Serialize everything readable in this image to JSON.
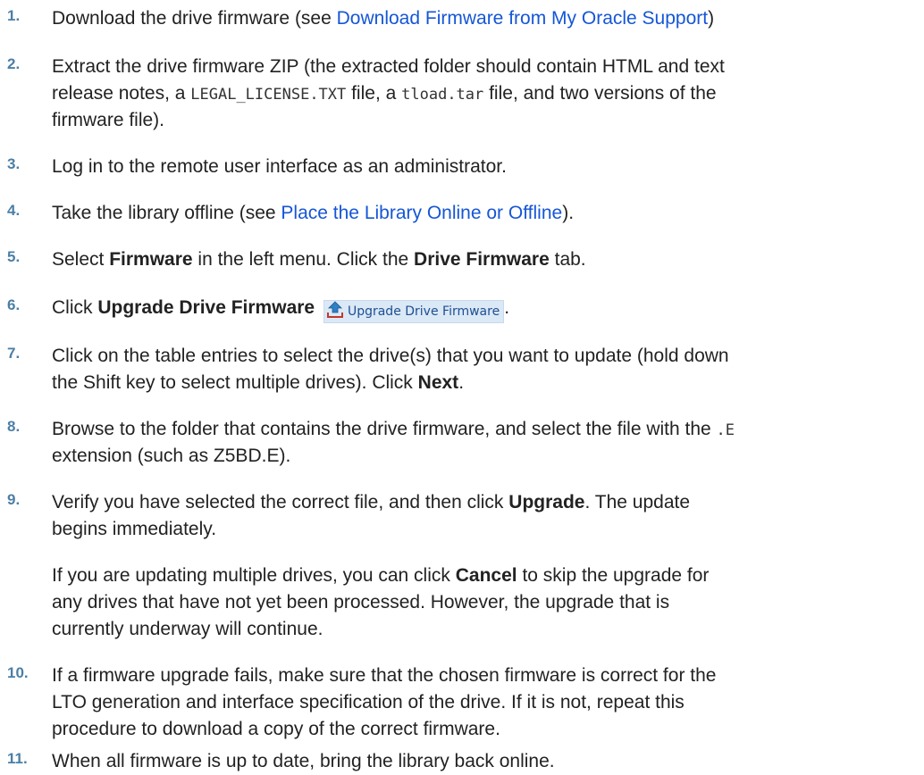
{
  "steps": [
    {
      "num": "1.",
      "pre": "Download the drive firmware (see ",
      "link": "Download Firmware from My Oracle Support",
      "post": ")"
    },
    {
      "num": "2.",
      "l1": "Extract the drive firmware ZIP (the extracted folder should contain HTML and text",
      "l2a": "release notes, a ",
      "code1": "LEGAL_LICENSE.TXT",
      "l2b": " file, a ",
      "code2": "tload.tar",
      "l2c": " file, and two versions of the",
      "l3": "firmware file)."
    },
    {
      "num": "3.",
      "text": "Log in to the remote user interface as an administrator."
    },
    {
      "num": "4.",
      "pre": "Take the library offline (see ",
      "link": "Place the Library Online or Offline",
      "post": ")."
    },
    {
      "num": "5.",
      "a": "Select ",
      "b1": "Firmware",
      "c": " in the left menu. Click the ",
      "b2": "Drive Firmware",
      "d": " tab."
    },
    {
      "num": "6.",
      "a": "Click ",
      "b1": "Upgrade Drive Firmware",
      "button_label": "Upgrade Drive Firmware",
      "post": "."
    },
    {
      "num": "7.",
      "l1": "Click on the table entries to select the drive(s) that you want to update (hold down",
      "l2a": "the Shift key to select multiple drives). Click ",
      "b1": "Next",
      "l2b": "."
    },
    {
      "num": "8.",
      "l1a": "Browse to the folder that contains the drive firmware, and select the file with the ",
      "code1": ".E",
      "l2": "extension (such as Z5BD.E)."
    },
    {
      "num": "9.",
      "l1a": "Verify you have selected the correct file, and then click ",
      "b1": "Upgrade",
      "l1b": ". The update",
      "l2": "begins immediately.",
      "p1a": "If you are updating multiple drives, you can click ",
      "p1b": "Cancel",
      "p1c": " to skip the upgrade for",
      "p2": "any drives that have not yet been processed. However, the upgrade that is",
      "p3": "currently underway will continue."
    },
    {
      "num": "10.",
      "l1": "If a firmware upgrade fails, make sure that the chosen firmware is correct for the",
      "l2": "LTO generation and interface specification of the drive. If it is not, repeat this",
      "l3": "procedure to download a copy of the correct firmware."
    },
    {
      "num": "11.",
      "text": "When all firmware is up to date, bring the library back online."
    }
  ],
  "colors": {
    "number": "#4c7fa6",
    "link": "#1556d6",
    "text": "#222222"
  },
  "icons": {
    "upgrade": "upload-arrow-icon"
  }
}
